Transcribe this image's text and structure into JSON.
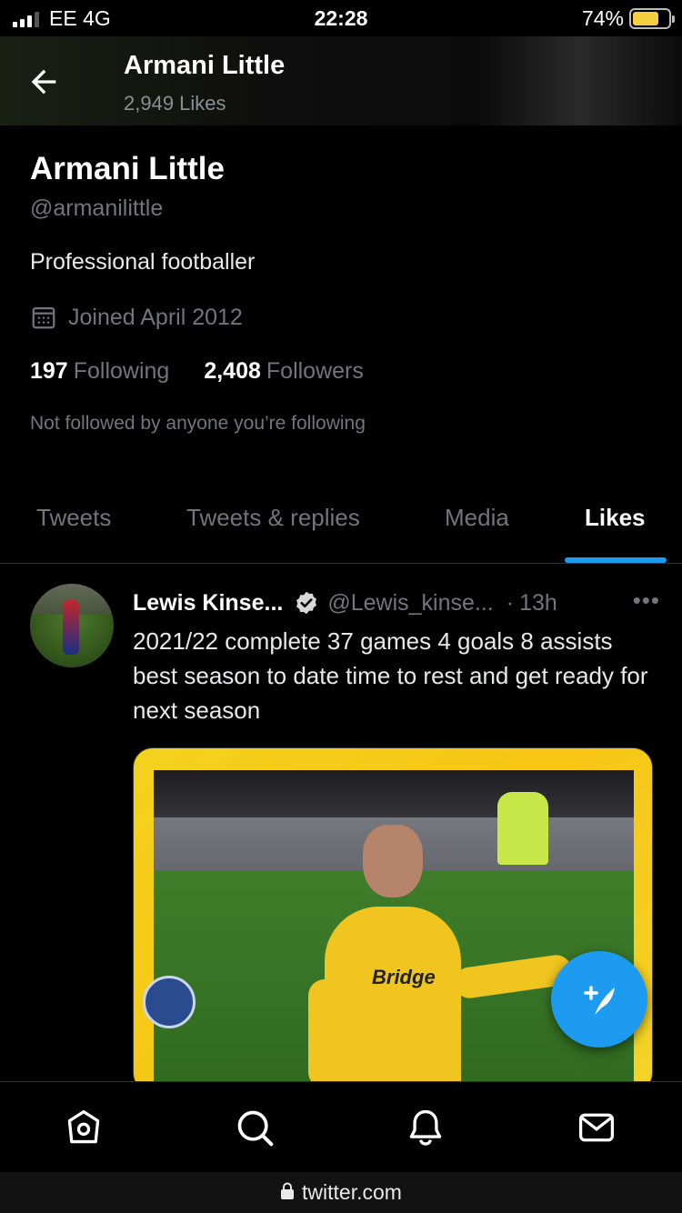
{
  "status_bar": {
    "carrier": "EE  4G",
    "time": "22:28",
    "battery_percent": "74%",
    "battery_level": 0.74
  },
  "header": {
    "title": "Armani Little",
    "subtitle": "2,949 Likes"
  },
  "profile": {
    "name": "Armani Little",
    "handle": "@armanilittle",
    "bio": "Professional footballer",
    "joined": "Joined April 2012",
    "following_count": "197",
    "following_label": "Following",
    "followers_count": "2,408",
    "followers_label": "Followers",
    "not_followed": "Not followed by anyone you’re following"
  },
  "tabs": [
    {
      "label": "Tweets",
      "active": false
    },
    {
      "label": "Tweets & replies",
      "active": false
    },
    {
      "label": "Media",
      "active": false
    },
    {
      "label": "Likes",
      "active": true
    }
  ],
  "tweet": {
    "author": "Lewis Kinse...",
    "handle": "@Lewis_kinse...",
    "separator": "·",
    "time": "13h",
    "more": "•••",
    "text": "2021/22 complete 37 games 4 goals 8 assists best season to date time to rest and get ready for next season",
    "media_sponsor": "Bridge"
  },
  "bottom_nav": [
    "home-icon",
    "search-icon",
    "bell-icon",
    "mail-icon"
  ],
  "browser": {
    "url": "twitter.com"
  },
  "colors": {
    "accent": "#1d9bf0",
    "background": "#000000",
    "secondary_text": "#71767b"
  }
}
